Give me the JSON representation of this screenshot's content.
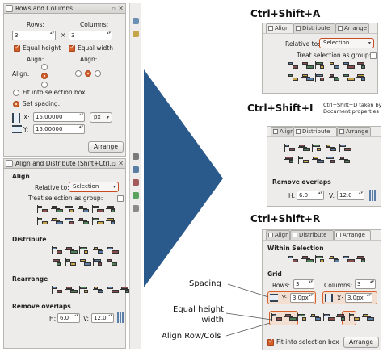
{
  "rows_cols_panel": {
    "title": "Rows and Columns",
    "rows_label": "Rows:",
    "columns_label": "Columns:",
    "rows_value": "3",
    "times": "×",
    "columns_value": "3",
    "equal_height": "Equal height",
    "equal_width": "Equal width",
    "align_col": "Align:",
    "align_row": "Align:",
    "fit_selection": "Fit into selection box",
    "set_spacing": "Set spacing:",
    "x_label": "X:",
    "x_value": "15.00000",
    "y_label": "Y:",
    "y_value": "15.00000",
    "unit": "px",
    "arrange_button": "Arrange"
  },
  "align_panel": {
    "title": "Align and Distribute (Shift+Ctrl...",
    "align_section": "Align",
    "relative_to_label": "Relative to:",
    "relative_to_value": "Selection",
    "treat_group": "Treat selection as group:",
    "distribute_section": "Distribute",
    "rearrange_section": "Rearrange",
    "remove_overlaps_section": "Remove overlaps",
    "h_label": "H:",
    "h_value": "6.0",
    "v_label": "V:",
    "v_value": "12.0"
  },
  "shortcut_a": {
    "heading": "Ctrl+Shift+A",
    "tab_align": "Align",
    "tab_distribute": "Distribute",
    "tab_arrange": "Arrange",
    "relative_to_label": "Relative to:",
    "relative_to_value": "Selection",
    "treat_group": "Treat selection as group:"
  },
  "shortcut_i": {
    "heading": "Ctrl+Shift+I",
    "note_line1": "Ctrl+Shift+D taken by",
    "note_line2": "Document properties",
    "tab_align": "Align",
    "tab_distribute": "Distribute",
    "tab_arrange": "Arrange",
    "remove_overlaps": "Remove overlaps",
    "h_label": "H:",
    "h_value": "6.0",
    "v_label": "V:",
    "v_value": "12.0"
  },
  "shortcut_r": {
    "heading": "Ctrl+Shift+R",
    "tab_align": "Align",
    "tab_distribute": "Distribute",
    "tab_arrange": "Arrange",
    "within_selection": "Within Selection",
    "grid": "Grid",
    "rows_label": "Rows:",
    "rows_value": "3",
    "columns_label": "Columns:",
    "columns_value": "3",
    "x_label": "X:",
    "x_value": "3.0px",
    "y_label": "Y:",
    "y_value": "3.0px",
    "fit_selection": "Fit into selection box",
    "arrange_button": "Arrange"
  },
  "callouts": {
    "spacing": "Spacing",
    "equal_hw_line1": "Equal height",
    "equal_hw_line2": "width",
    "align_rowcols": "Align Row/Cols"
  },
  "colors": {
    "accent": "#d35f2a",
    "arrow": "#2a5a8c",
    "panel_bg": "#edeceb"
  }
}
